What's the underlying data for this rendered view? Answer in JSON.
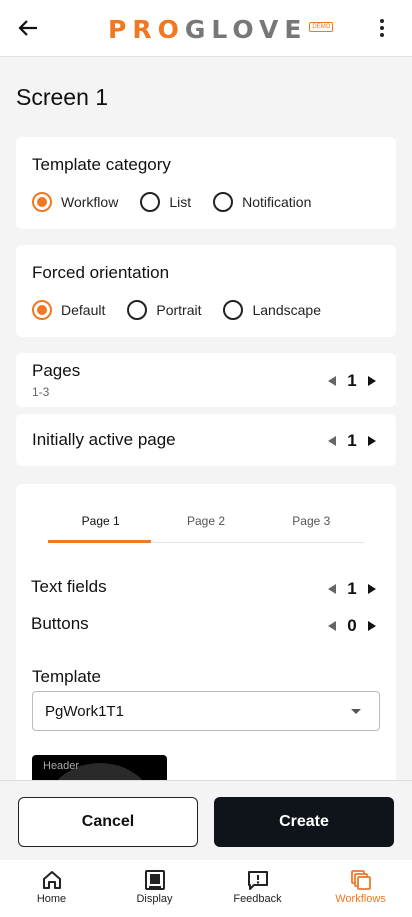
{
  "appbar": {
    "logo_pro": "PRO",
    "logo_glove": "GLOVE",
    "logo_badge": "DEMO",
    "back_icon": "arrow-left-icon",
    "more_icon": "more-vertical-icon"
  },
  "screen": {
    "title": "Screen 1"
  },
  "template_category": {
    "title": "Template category",
    "options": [
      "Workflow",
      "List",
      "Notification"
    ],
    "selected": "Workflow"
  },
  "forced_orientation": {
    "title": "Forced orientation",
    "options": [
      "Default",
      "Portrait",
      "Landscape"
    ],
    "selected": "Default"
  },
  "pages": {
    "label": "Pages",
    "range": "1-3",
    "value": "1"
  },
  "initially_active_page": {
    "label": "Initially active page",
    "value": "1"
  },
  "page_editor": {
    "tabs": [
      "Page 1",
      "Page 2",
      "Page 3"
    ],
    "active_tab": "Page 1",
    "text_fields": {
      "label": "Text fields",
      "value": "1"
    },
    "buttons": {
      "label": "Buttons",
      "value": "0"
    },
    "template": {
      "label": "Template",
      "selected": "PgWork1T1"
    },
    "preview": {
      "header": "Header"
    }
  },
  "actions": {
    "cancel": "Cancel",
    "create": "Create"
  },
  "bottom_nav": {
    "items": [
      {
        "label": "Home",
        "icon": "home-icon"
      },
      {
        "label": "Display",
        "icon": "display-icon"
      },
      {
        "label": "Feedback",
        "icon": "feedback-icon"
      },
      {
        "label": "Workflows",
        "icon": "workflows-icon"
      }
    ],
    "active": "Workflows"
  },
  "colors": {
    "accent": "#f07822",
    "primary_button": "#0e1419",
    "background": "#f4f4f4"
  }
}
